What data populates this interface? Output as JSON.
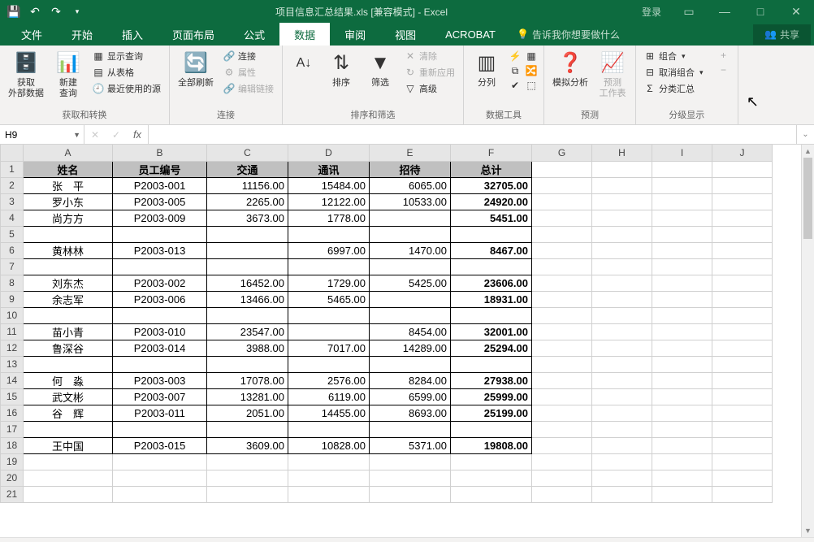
{
  "titlebar": {
    "doc_title": "项目信息汇总结果.xls  [兼容模式] - Excel",
    "login": "登录"
  },
  "tabs": {
    "file": "文件",
    "home": "开始",
    "insert": "插入",
    "layout": "页面布局",
    "formulas": "公式",
    "data": "数据",
    "review": "审阅",
    "view": "视图",
    "acrobat": "ACROBAT",
    "tell_me": "告诉我你想要做什么",
    "share": "共享"
  },
  "ribbon": {
    "g1": {
      "label": "获取和转换",
      "ext_data": "获取\n外部数据",
      "new_query": "新建\n查询",
      "show_queries": "显示查询",
      "from_table": "从表格",
      "recent": "最近使用的源"
    },
    "g2": {
      "label": "连接",
      "refresh_all": "全部刷新",
      "connections": "连接",
      "properties": "属性",
      "edit_links": "编辑链接"
    },
    "g3": {
      "label": "排序和筛选",
      "sort": "排序",
      "filter": "筛选",
      "clear": "清除",
      "reapply": "重新应用",
      "advanced": "高级"
    },
    "g4": {
      "label": "数据工具",
      "text_to_cols": "分列"
    },
    "g5": {
      "label": "预测",
      "whatif": "模拟分析",
      "forecast": "预测\n工作表"
    },
    "g6": {
      "label": "分级显示",
      "group": "组合",
      "ungroup": "取消组合",
      "subtotal": "分类汇总"
    }
  },
  "formulabar": {
    "namebox": "H9",
    "formula": ""
  },
  "columns": [
    "A",
    "B",
    "C",
    "D",
    "E",
    "F",
    "G",
    "H",
    "I",
    "J"
  ],
  "headers": {
    "A": "姓名",
    "B": "员工编号",
    "C": "交通",
    "D": "通讯",
    "E": "招待",
    "F": "总计"
  },
  "rows": [
    {
      "r": 2,
      "A": "张　平",
      "B": "P2003-001",
      "C": "11156.00",
      "D": "15484.00",
      "E": "6065.00",
      "F": "32705.00"
    },
    {
      "r": 3,
      "A": "罗小东",
      "B": "P2003-005",
      "C": "2265.00",
      "D": "12122.00",
      "E": "10533.00",
      "F": "24920.00"
    },
    {
      "r": 4,
      "A": "尚方方",
      "B": "P2003-009",
      "C": "3673.00",
      "D": "1778.00",
      "E": "",
      "F": "5451.00"
    },
    {
      "r": 5,
      "A": "",
      "B": "",
      "C": "",
      "D": "",
      "E": "",
      "F": ""
    },
    {
      "r": 6,
      "A": "黄林林",
      "B": "P2003-013",
      "C": "",
      "D": "6997.00",
      "E": "1470.00",
      "F": "8467.00"
    },
    {
      "r": 7,
      "A": "",
      "B": "",
      "C": "",
      "D": "",
      "E": "",
      "F": ""
    },
    {
      "r": 8,
      "A": "刘东杰",
      "B": "P2003-002",
      "C": "16452.00",
      "D": "1729.00",
      "E": "5425.00",
      "F": "23606.00"
    },
    {
      "r": 9,
      "A": "余志军",
      "B": "P2003-006",
      "C": "13466.00",
      "D": "5465.00",
      "E": "",
      "F": "18931.00"
    },
    {
      "r": 10,
      "A": "",
      "B": "",
      "C": "",
      "D": "",
      "E": "",
      "F": ""
    },
    {
      "r": 11,
      "A": "苗小青",
      "B": "P2003-010",
      "C": "23547.00",
      "D": "",
      "E": "8454.00",
      "F": "32001.00"
    },
    {
      "r": 12,
      "A": "鲁深谷",
      "B": "P2003-014",
      "C": "3988.00",
      "D": "7017.00",
      "E": "14289.00",
      "F": "25294.00"
    },
    {
      "r": 13,
      "A": "",
      "B": "",
      "C": "",
      "D": "",
      "E": "",
      "F": ""
    },
    {
      "r": 14,
      "A": "何　淼",
      "B": "P2003-003",
      "C": "17078.00",
      "D": "2576.00",
      "E": "8284.00",
      "F": "27938.00"
    },
    {
      "r": 15,
      "A": "武文彬",
      "B": "P2003-007",
      "C": "13281.00",
      "D": "6119.00",
      "E": "6599.00",
      "F": "25999.00"
    },
    {
      "r": 16,
      "A": "谷　辉",
      "B": "P2003-011",
      "C": "2051.00",
      "D": "14455.00",
      "E": "8693.00",
      "F": "25199.00"
    },
    {
      "r": 17,
      "A": "",
      "B": "",
      "C": "",
      "D": "",
      "E": "",
      "F": ""
    },
    {
      "r": 18,
      "A": "王中国",
      "B": "P2003-015",
      "C": "3609.00",
      "D": "10828.00",
      "E": "5371.00",
      "F": "19808.00"
    }
  ],
  "blank_rows": [
    19,
    20,
    21
  ]
}
